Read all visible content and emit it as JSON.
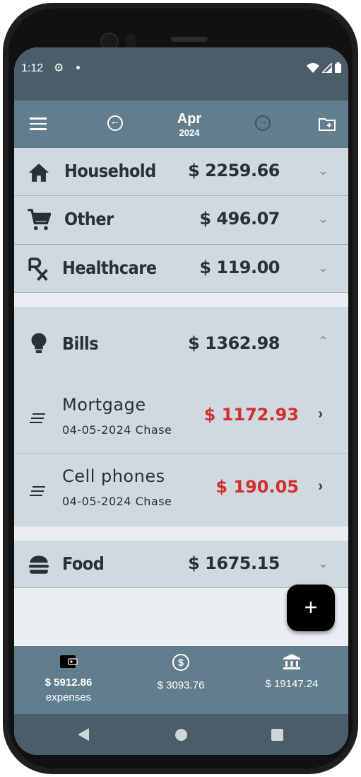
{
  "status": {
    "time": "1:12"
  },
  "appbar": {
    "month": "Apr",
    "year": "2024"
  },
  "categories": [
    {
      "name": "Household",
      "amount": "$ 2259.66",
      "icon": "home-icon"
    },
    {
      "name": "Other",
      "amount": "$ 496.07",
      "icon": "cart-icon"
    },
    {
      "name": "Healthcare",
      "amount": "$ 119.00",
      "icon": "rx-icon"
    },
    {
      "name": "Bills",
      "amount": "$ 1362.98",
      "icon": "lightbulb-icon"
    },
    {
      "name": "Food",
      "amount": "$ 1675.15",
      "icon": "burger-icon"
    }
  ],
  "transactions": [
    {
      "name": "Mortgage",
      "sub": "04-05-2024 Chase",
      "amount": "$ 1172.93"
    },
    {
      "name": "Cell phones",
      "sub": "04-05-2024 Chase",
      "amount": "$ 190.05"
    }
  ],
  "fab": {
    "label": "+"
  },
  "nav": [
    {
      "value": "$ 5912.86",
      "label": "expenses",
      "icon": "wallet-icon"
    },
    {
      "value": "$ 3093.76",
      "label": "",
      "icon": "dollar-circle-icon"
    },
    {
      "value": "$ 19147.24",
      "label": "",
      "icon": "bank-icon"
    }
  ],
  "colors": {
    "accent": "#627d8b",
    "negative": "#d32f2f",
    "surface": "#cfd9df"
  }
}
